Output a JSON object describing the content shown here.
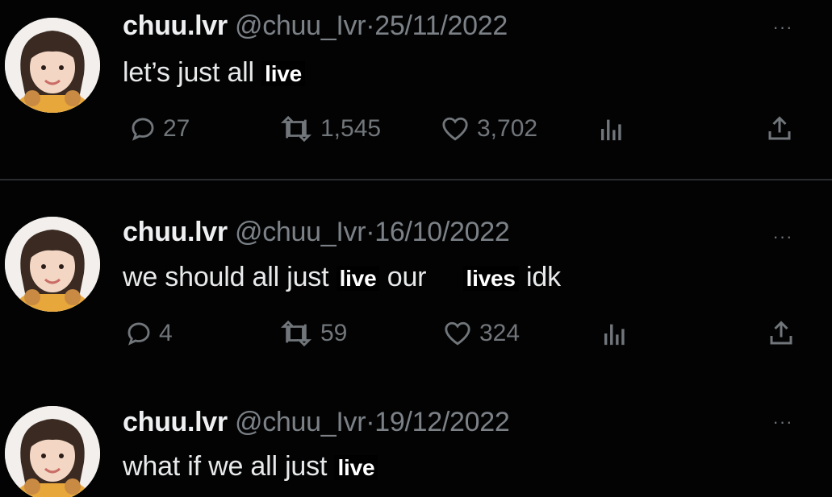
{
  "tweets": [
    {
      "name": "chuu.lvr",
      "handle": "@chuu_Ivr",
      "dot": "·",
      "date": "25/11/2022",
      "text": {
        "plain1": "let’s just all ",
        "bold1": "live"
      },
      "replies": "27",
      "retweets": "1,545",
      "likes": "3,702"
    },
    {
      "name": "chuu.lvr",
      "handle": "@chuu_Ivr",
      "dot": "·",
      "date": "16/10/2022",
      "text": {
        "plain1": "we should all just ",
        "bold1": "live",
        "plain2": " our ",
        "bold2": "lives",
        "plain3": " idk"
      },
      "replies": "4",
      "retweets": "59",
      "likes": "324"
    },
    {
      "name": "chuu.lvr",
      "handle": "@chuu_Ivr",
      "dot": "·",
      "date": "19/12/2022",
      "text": {
        "plain1": "what if we all just ",
        "bold1": "live"
      }
    }
  ],
  "menu_glyph": "···",
  "icons": {
    "reply": "reply-icon",
    "retweet": "retweet-icon",
    "like": "heart-icon",
    "views": "analytics-icon",
    "share": "share-icon",
    "more": "more-icon"
  },
  "colors": {
    "background": "#030303",
    "text": "#e7e9ea",
    "muted": "#71767b",
    "avatar_bg": "#f4f1ee"
  }
}
